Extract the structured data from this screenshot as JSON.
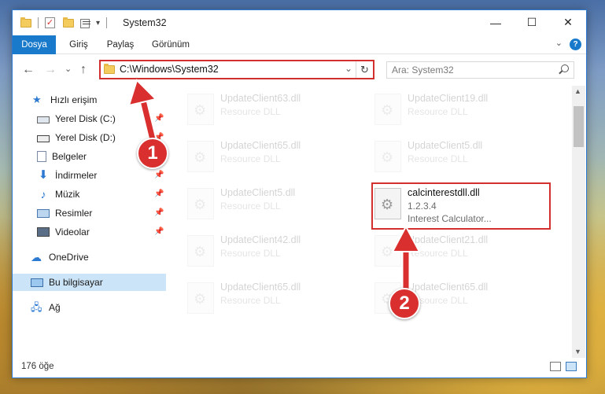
{
  "window": {
    "title": "System32"
  },
  "titlebar": {
    "minimize_glyph": "—",
    "maximize_glyph": "☐",
    "close_glyph": "✕",
    "dropdown_glyph": "▾"
  },
  "ribbon": {
    "tabs": [
      "Dosya",
      "Giriş",
      "Paylaş",
      "Görünüm"
    ],
    "help_glyph": "?",
    "collapse_glyph": "⌄"
  },
  "nav": {
    "back_glyph": "←",
    "forward_glyph": "→",
    "recent_glyph": "⌄",
    "up_glyph": "↑"
  },
  "address": {
    "path": "C:\\Windows\\System32",
    "chevron": "⌄",
    "refresh_glyph": "↻"
  },
  "search": {
    "placeholder": "Ara: System32"
  },
  "sidebar": {
    "pin_glyph": "📌",
    "items": [
      {
        "label": "Hızlı erişim",
        "icon": "star-icon"
      },
      {
        "label": "Yerel Disk (C:)",
        "icon": "drive-icon"
      },
      {
        "label": "Yerel Disk (D:)",
        "icon": "drive-icon"
      },
      {
        "label": "Belgeler",
        "icon": "documents-icon"
      },
      {
        "label": "İndirmeler",
        "icon": "downloads-icon"
      },
      {
        "label": "Müzik",
        "icon": "music-icon"
      },
      {
        "label": "Resimler",
        "icon": "pictures-icon"
      },
      {
        "label": "Videolar",
        "icon": "videos-icon"
      },
      {
        "label": "OneDrive",
        "icon": "onedrive-icon"
      },
      {
        "label": "Bu bilgisayar",
        "icon": "computer-icon"
      },
      {
        "label": "Ağ",
        "icon": "network-icon"
      }
    ]
  },
  "files": [
    {
      "name": "UpdateClient63.dll",
      "type": "Resource DLL"
    },
    {
      "name": "UpdateClient19.dll",
      "type": "Resource DLL"
    },
    {
      "name": "UpdateClient65.dll",
      "type": "Resource DLL"
    },
    {
      "name": "UpdateClient5.dll",
      "type": "Resource DLL"
    },
    {
      "name": "UpdateClient5.dll",
      "type": "Resource DLL"
    },
    {
      "name": "calcinterestdll.dll",
      "version": "1.2.3.4",
      "type": "Interest Calculator..."
    },
    {
      "name": "UpdateClient42.dll",
      "type": "Resource DLL"
    },
    {
      "name": "UpdateClient21.dll",
      "type": "Resource DLL"
    },
    {
      "name": "UpdateClient65.dll",
      "type": "Resource DLL"
    },
    {
      "name": "UpdateClient65.dll",
      "type": "Resource DLL"
    }
  ],
  "status": {
    "count": "176 öğe"
  },
  "annotations": {
    "step1": "1",
    "step2": "2",
    "color": "#d9302f"
  }
}
